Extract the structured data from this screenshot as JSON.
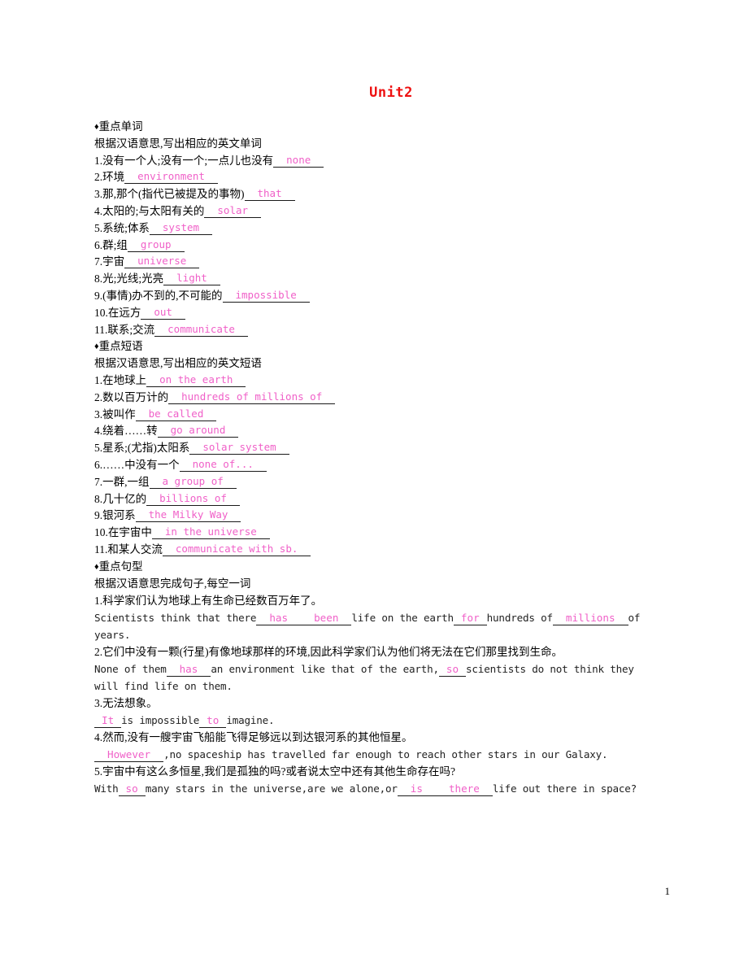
{
  "document": {
    "title": "Unit2",
    "title_color": "#ee1111",
    "answer_color": "#f060c8",
    "page_number": "1"
  },
  "sections": {
    "words": {
      "bullet": "♦",
      "heading": "重点单词",
      "instruction": "根据汉语意思,写出相应的英文单词",
      "items": [
        {
          "num": "1.",
          "prompt": "没有一个人;没有一个;一点儿也没有",
          "answer": "none"
        },
        {
          "num": "2.",
          "prompt": "环境",
          "answer": "environment"
        },
        {
          "num": "3.",
          "prompt": "那,那个(指代已被提及的事物)",
          "answer": "that"
        },
        {
          "num": "4.",
          "prompt": "太阳的;与太阳有关的",
          "answer": "solar"
        },
        {
          "num": "5.",
          "prompt": "系统;体系",
          "answer": "system"
        },
        {
          "num": "6.",
          "prompt": "群;组",
          "answer": "group"
        },
        {
          "num": "7.",
          "prompt": "宇宙",
          "answer": "universe"
        },
        {
          "num": "8.",
          "prompt": "光;光线;光亮",
          "answer": "light"
        },
        {
          "num": "9.",
          "prompt": "(事情)办不到的,不可能的",
          "answer": "impossible"
        },
        {
          "num": "10.",
          "prompt": "在远方",
          "answer": "out"
        },
        {
          "num": "11.",
          "prompt": "联系;交流",
          "answer": "communicate"
        }
      ]
    },
    "phrases": {
      "bullet": "♦",
      "heading": "重点短语",
      "instruction": "根据汉语意思,写出相应的英文短语",
      "items": [
        {
          "num": "1.",
          "prompt": "在地球上",
          "answer": "on the earth"
        },
        {
          "num": "2.",
          "prompt": "数以百万计的",
          "answer": "hundreds of millions of"
        },
        {
          "num": "3.",
          "prompt": "被叫作",
          "answer": "be called"
        },
        {
          "num": "4.",
          "prompt": "绕着……转",
          "answer": "go around"
        },
        {
          "num": "5.",
          "prompt": "星系;(尤指)太阳系",
          "answer": "solar system"
        },
        {
          "num": "6.",
          "prompt": "……中没有一个",
          "answer": "none of..."
        },
        {
          "num": "7.",
          "prompt": "一群,一组",
          "answer": "a group of"
        },
        {
          "num": "8.",
          "prompt": "几十亿的",
          "answer": "billions of"
        },
        {
          "num": "9.",
          "prompt": "银河系",
          "answer": "the Milky Way"
        },
        {
          "num": "10.",
          "prompt": "在宇宙中",
          "answer": "in the universe"
        },
        {
          "num": "11.",
          "prompt": "和某人交流",
          "answer": "communicate with sb."
        }
      ]
    },
    "sentences": {
      "bullet": "♦",
      "heading": "重点句型",
      "instruction": "根据汉语意思完成句子,每空一词",
      "items": [
        {
          "num": "1.",
          "chinese": "科学家们认为地球上有生命已经数百万年了。",
          "parts": [
            {
              "type": "text",
              "value": "Scientists think that there"
            },
            {
              "type": "blank",
              "value": "has",
              "size": "lg"
            },
            {
              "type": "blank",
              "value": "been",
              "size": "lg"
            },
            {
              "type": "text",
              "value": "life on the earth"
            },
            {
              "type": "blank",
              "value": "for",
              "size": "sm"
            },
            {
              "type": "text",
              "value": "hundreds of"
            },
            {
              "type": "blank",
              "value": "millions",
              "size": "lg"
            },
            {
              "type": "text",
              "value": "of"
            }
          ],
          "continuation": "years."
        },
        {
          "num": "2.",
          "chinese": "它们中没有一颗(行星)有像地球那样的环境,因此科学家们认为他们将无法在它们那里找到生命。",
          "parts": [
            {
              "type": "text",
              "value": "None of them"
            },
            {
              "type": "blank",
              "value": "has",
              "size": "lg"
            },
            {
              "type": "text",
              "value": "an environment like that of the earth,"
            },
            {
              "type": "blank",
              "value": "so",
              "size": "sm"
            },
            {
              "type": "text",
              "value": "scientists do not think they"
            }
          ],
          "continuation": "will find life on them."
        },
        {
          "num": "3.",
          "chinese": "无法想象。",
          "parts": [
            {
              "type": "blank",
              "value": "It",
              "size": "sm"
            },
            {
              "type": "text",
              "value": "is impossible"
            },
            {
              "type": "blank",
              "value": "to",
              "size": "sm"
            },
            {
              "type": "text",
              "value": "imagine."
            }
          ],
          "continuation": ""
        },
        {
          "num": "4.",
          "chinese": "然而,没有一艘宇宙飞船能飞得足够远以到达银河系的其他恒星。",
          "parts": [
            {
              "type": "blank",
              "value": "However",
              "size": "lg"
            },
            {
              "type": "text",
              "value": ",no spaceship has travelled far enough to reach other stars in our Galaxy."
            }
          ],
          "continuation": ""
        },
        {
          "num": "5.",
          "chinese": "宇宙中有这么多恒星,我们是孤独的吗?或者说太空中还有其他生命存在吗?",
          "parts": [
            {
              "type": "text",
              "value": "With"
            },
            {
              "type": "blank",
              "value": "so",
              "size": "sm"
            },
            {
              "type": "text",
              "value": "many stars in the universe,are we alone,or"
            },
            {
              "type": "blank",
              "value": "is",
              "size": "lg"
            },
            {
              "type": "blank",
              "value": "there",
              "size": "lg"
            },
            {
              "type": "text",
              "value": "life out there in space?"
            }
          ],
          "continuation": ""
        }
      ]
    }
  }
}
